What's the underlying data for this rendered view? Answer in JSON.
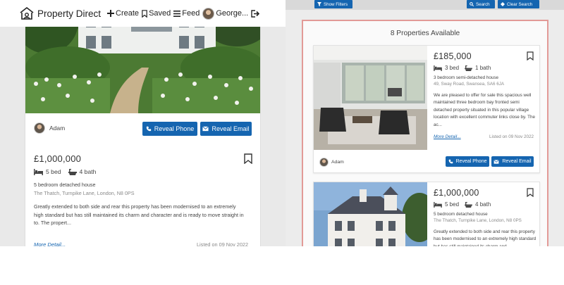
{
  "navbar": {
    "brand": "Property Direct",
    "items": [
      {
        "label": "Create",
        "icon": "plus-icon"
      },
      {
        "label": "Saved",
        "icon": "bookmark-icon"
      },
      {
        "label": "Feed",
        "icon": "menu-icon"
      },
      {
        "label": "George...",
        "icon": "avatar"
      },
      {
        "label": "",
        "icon": "logout-icon"
      }
    ]
  },
  "mobile": {
    "card1": {
      "agent": "Adam",
      "reveal_phone": "Reveal Phone",
      "reveal_email": "Reveal Email"
    },
    "card2": {
      "price": "£1,000,000",
      "beds": "5 bed",
      "baths": "4 bath",
      "type": "5 bedroom detached house",
      "address": "The Thatch, Turnpike Lane, London, N8 0PS",
      "description": "Greatly extended to both side and rear this property has been modernised to an extremely high standard but has still maintained its charm and character and is ready to move straight in to. The propert...",
      "more": "More Detail...",
      "listed": "Listed on 09 Nov 2022"
    }
  },
  "desktop": {
    "filters": {
      "show_filters": "Show Filters",
      "search": "Search",
      "clear_search": "Clear Search"
    },
    "results_title": "8 Properties Available",
    "cards": [
      {
        "price": "£185,000",
        "beds": "3 bed",
        "baths": "1 bath",
        "type": "3 bedroom semi-detached house",
        "address": "49, Sway Road, Swansea, SA6 6JA",
        "description": "We are pleased to offer for sale this spacious well maintained three bedroom bay fronted semi detached property situated in this popular village location with excellent commuter links close by. The ac...",
        "more": "More Detail...",
        "listed": "Listed on 09 Nov 2022",
        "agent": "Adam",
        "reveal_phone": "Reveal Phone",
        "reveal_email": "Reveal Email"
      },
      {
        "price": "£1,000,000",
        "beds": "5 bed",
        "baths": "4 bath",
        "type": "5 bedroom detached house",
        "address": "The Thatch, Turnpike Lane, London, N8 0PS",
        "description": "Greatly extended to both side and rear this property has been modernised to an extremely high standard but has still maintained its charm and"
      }
    ]
  },
  "colors": {
    "primary_button": "#1565b0",
    "results_border": "#e29a97",
    "link": "#1565b0"
  }
}
